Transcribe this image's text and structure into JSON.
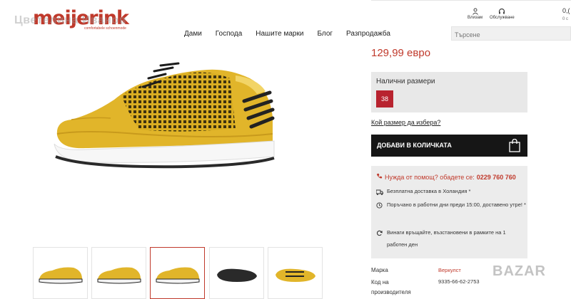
{
  "header": {
    "logo": "meijerink",
    "logo_tagline": "comfortabele schoenmode",
    "watermark_text": "Цветелина Иванов",
    "nav": [
      "Дами",
      "Господа",
      "Нашите марки",
      "Блог",
      "Разпродажба"
    ],
    "login_label": "Влизам",
    "service_label": "Обслужване",
    "cart_count": "0,(",
    "cart_sub": "0 с",
    "search_placeholder": "Търсене"
  },
  "product": {
    "price": "129,99 евро",
    "sizes_label": "Налични размери",
    "sizes": [
      "38"
    ],
    "size_guide": "Кой размер да избера?",
    "add_to_cart": "ДОБАВИ В КОЛИЧКАТА",
    "help_text": "Нужда от помощ? обадете се:",
    "help_phone": "0229 760 760",
    "info_delivery": "Безплатна доставка в Холандия *",
    "info_order": "Поръчано в работни дни преди 15:00, доставено утре! *",
    "info_returns": "Винаги връщайте, възстановени в рамките на 1 работен ден",
    "brand_label": "Марка",
    "brand_value": "Веркулст",
    "code_label": "Код на производителя",
    "code_value": "9335-66-62-2753"
  },
  "colors": {
    "accent": "#c0392b",
    "shoe": "#e1b52a",
    "button": "#161616"
  },
  "thumbnails_count": 5,
  "watermark": "BAZAR"
}
